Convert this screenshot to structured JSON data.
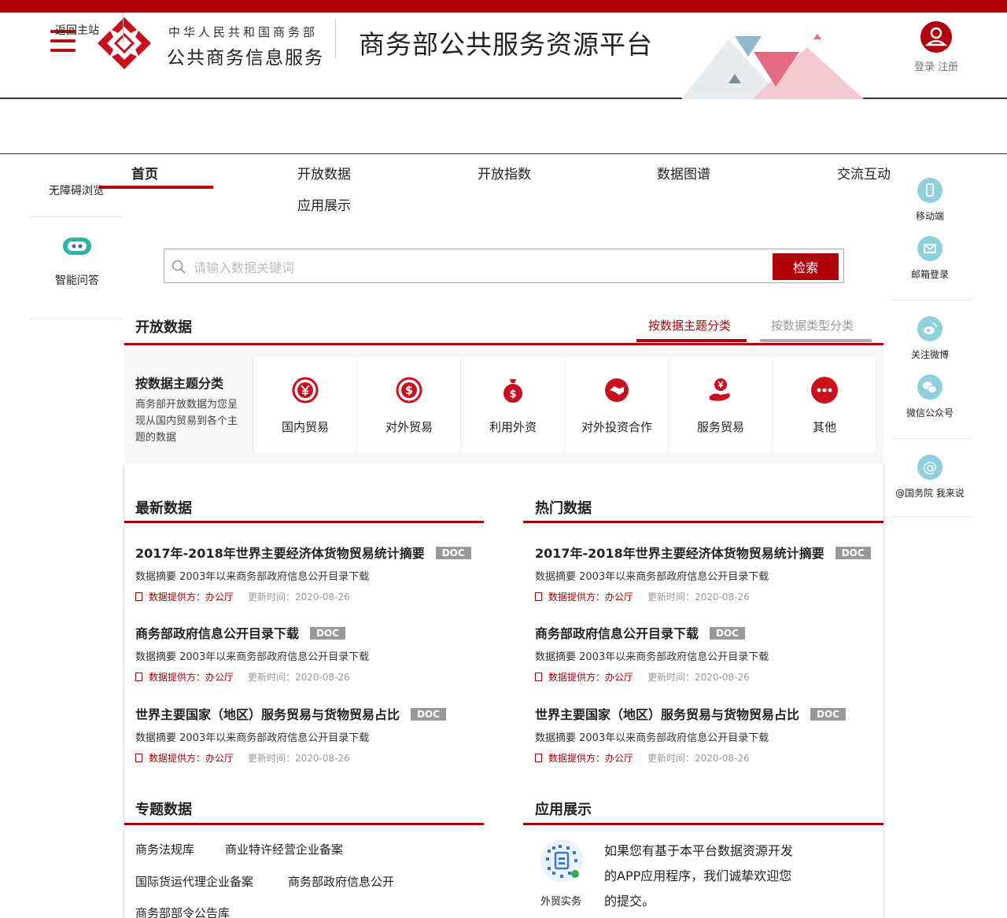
{
  "header": {
    "org_top": "中华人民共和国商务部",
    "org_main": "公共商务信息服务",
    "platform_title": "商务部公共服务资源平台",
    "login_label": "登录 注册",
    "accent_color": "#b0000b"
  },
  "subbar": {
    "back_label": "返回主站"
  },
  "left_rail": {
    "accessibility": "无障碍浏览",
    "smart_qa": "智能问答"
  },
  "nav": {
    "items": [
      "首页",
      "开放数据",
      "开放指数",
      "数据图谱",
      "交流互动",
      "应用展示"
    ]
  },
  "search": {
    "placeholder": "请输入数据关键词",
    "button": "检索"
  },
  "open_data": {
    "title": "开放数据",
    "tab_active": "按数据主题分类",
    "tab_inactive": "按数据类型分类",
    "intro_title": "按数据主题分类",
    "intro_desc": "商务部开放数据为您呈现从国内贸易到各个主题的数据",
    "categories": [
      {
        "label": "国内贸易",
        "icon": "yen-circle-icon"
      },
      {
        "label": "对外贸易",
        "icon": "dollar-circle-icon"
      },
      {
        "label": "利用外资",
        "icon": "money-bag-icon"
      },
      {
        "label": "对外投资合作",
        "icon": "handshake-icon"
      },
      {
        "label": "服务贸易",
        "icon": "hand-yen-icon"
      },
      {
        "label": "其他",
        "icon": "more-icon"
      }
    ]
  },
  "right_rail": {
    "items": [
      {
        "label": "移动端",
        "icon": "mobile-icon"
      },
      {
        "label": "邮箱登录",
        "icon": "mail-icon"
      },
      {
        "label": "关注微博",
        "icon": "weibo-icon"
      },
      {
        "label": "微信公众号",
        "icon": "wechat-icon"
      },
      {
        "label": "@国务院 我来说",
        "icon": "at-icon"
      }
    ]
  },
  "latest": {
    "title": "最新数据",
    "items": [
      {
        "title": "2017年-2018年世界主要经济体货物贸易统计摘要",
        "badge": "DOC",
        "desc": "数据摘要 2003年以来商务部政府信息公开目录下载",
        "provider": "数据提供方：办公厅",
        "updated": "更新时间：2020-08-26"
      },
      {
        "title": "商务部政府信息公开目录下载",
        "badge": "DOC",
        "desc": "数据摘要 2003年以来商务部政府信息公开目录下载",
        "provider": "数据提供方：办公厅",
        "updated": "更新时间：2020-08-26"
      },
      {
        "title": "世界主要国家（地区）服务贸易与货物贸易占比",
        "badge": "DOC",
        "desc": "数据摘要 2003年以来商务部政府信息公开目录下载",
        "provider": "数据提供方：办公厅",
        "updated": "更新时间：2020-08-26"
      }
    ]
  },
  "hot": {
    "title": "热门数据",
    "items": [
      {
        "title": "2017年-2018年世界主要经济体货物贸易统计摘要",
        "badge": "DOC",
        "desc": "数据摘要 2003年以来商务部政府信息公开目录下载",
        "provider": "数据提供方：办公厅",
        "updated": "更新时间：2020-08-26"
      },
      {
        "title": "商务部政府信息公开目录下载",
        "badge": "DOC",
        "desc": "数据摘要 2003年以来商务部政府信息公开目录下载",
        "provider": "数据提供方：办公厅",
        "updated": "更新时间：2020-08-26"
      },
      {
        "title": "世界主要国家（地区）服务贸易与货物贸易占比",
        "badge": "DOC",
        "desc": "数据摘要 2003年以来商务部政府信息公开目录下载",
        "provider": "数据提供方：办公厅",
        "updated": "更新时间：2020-08-26"
      }
    ]
  },
  "topics": {
    "title": "专题数据",
    "links": [
      "商务法规库",
      "商业特许经营企业备案",
      "国际货运代理企业备案",
      "商务部政府信息公开",
      "商务部部令公告库"
    ]
  },
  "apps": {
    "title": "应用展示",
    "qr_label": "外贸实务",
    "text": "如果您有基于本平台数据资源开发的APP应用程序，我们诚挚欢迎您的提交。"
  }
}
